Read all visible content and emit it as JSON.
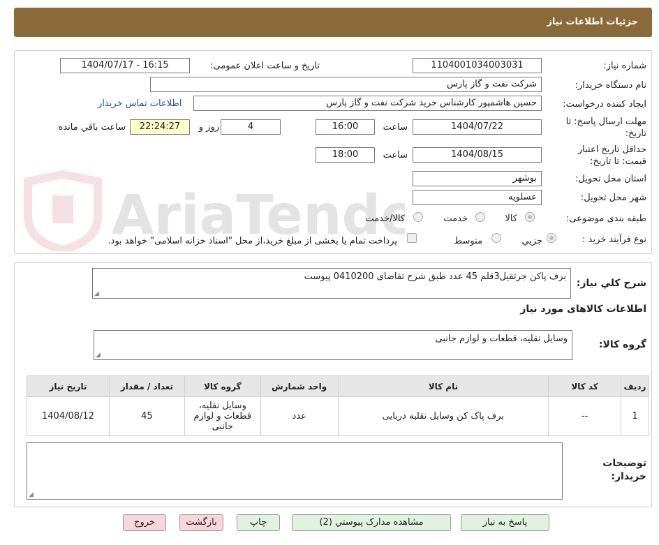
{
  "header": {
    "title": "جزئیات اطلاعات نیاز"
  },
  "form": {
    "need_number_label": "شماره نیاز:",
    "need_number": "1104001034003031",
    "announce_label": "تاریخ و ساعت اعلان عمومی:",
    "announce_value": "1404/07/17 - 16:15",
    "buyer_org_label": "نام دستگاه خریدار:",
    "buyer_org": "شرکت نفت و گاز پارس",
    "requester_label": "ایجاد کننده درخواست:",
    "requester": "حسین هاشمپور کارشناس خرید شرکت نفت و گاز پارس",
    "buyer_contact_link": "اطلاعات تماس خریدار",
    "deadline_label_1": "مهلت ارسال پاسخ: تا",
    "deadline_label_2": "تاریخ:",
    "deadline_date": "1404/07/22",
    "hour_label": "ساعت",
    "deadline_time": "16:00",
    "days_value": "4",
    "days_label": "روز و",
    "remaining_time": "22:24:27",
    "remaining_label": "ساعت باقي مانده",
    "validity_label_1": "حداقل تاریخ اعتبار",
    "validity_label_2": "قیمت: تا تاریخ:",
    "validity_date": "1404/08/15",
    "validity_hour_label": "ساعت",
    "validity_time": "18:00",
    "province_label": "استان محل تحویل:",
    "province": "بوشهر",
    "city_label": "شهر محل تحویل:",
    "city": "عسلویه",
    "category_label": "طبقه بندی موضوعی:",
    "category_options": [
      "کالا",
      "خدمت",
      "کالا/خدمت"
    ],
    "process_label": "نوع فرآیند خرید :",
    "process_options": [
      "جزیي",
      "متوسط"
    ],
    "payment_note": "پرداخت تمام یا بخشی از مبلغ خرید،از محل \"اسناد خزانه اسلامی\" خواهد بود."
  },
  "details": {
    "description_label": "شرح کلي نياز:",
    "description": "برف پاکن جرثقیل3قلم 45 عدد طبق شرح تقاضای 0410200 پیوست",
    "goods_info_title": "اطلاعات کالاهای مورد نیاز",
    "goods_group_label": "گروه کالا:",
    "goods_group": "وسایل نقلیه، قطعات و لوازم جانبی",
    "table": {
      "headers": [
        "ردیف",
        "کد کالا",
        "نام کالا",
        "واحد شمارش",
        "گروه کالا",
        "تعداد / مقدار",
        "تاریخ نیاز"
      ],
      "rows": [
        [
          "1",
          "--",
          "برف پاک کن وسایل نقلیه دریایی",
          "عدد",
          "وسایل نقلیه، قطعات و لوازم جانبی",
          "45",
          "1404/08/12"
        ]
      ]
    },
    "buyer_notes_label_1": "توضیحات",
    "buyer_notes_label_2": "خریدار:"
  },
  "buttons": {
    "reply": "پاسخ به نیاز",
    "attachments": "مشاهده مدارک پیوستي (2)",
    "print": "چاپ",
    "back": "بازگشت",
    "exit": "خروج"
  }
}
